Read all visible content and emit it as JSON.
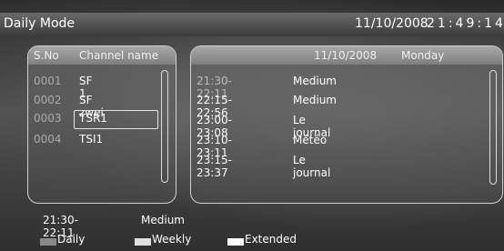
{
  "title_bar": {
    "title": "Daily Mode",
    "date": "11/10/2008",
    "time": "21:49:14"
  },
  "channel_panel": {
    "header": {
      "sno": "S.No",
      "name": "Channel name"
    },
    "channels": [
      {
        "sno": "0001",
        "name": "SF 1"
      },
      {
        "sno": "0002",
        "name": "SF zwei"
      },
      {
        "sno": "0003",
        "name": "TSR1"
      },
      {
        "sno": "0004",
        "name": "TSI1"
      }
    ],
    "selected_index": 2
  },
  "epg_panel": {
    "header": {
      "date": "11/10/2008",
      "day": "Monday"
    },
    "events": [
      {
        "time": "21:30-22:11",
        "title": "Medium"
      },
      {
        "time": "22:15-22:56",
        "title": "Medium"
      },
      {
        "time": "23:00-23:08",
        "title": "Le journal"
      },
      {
        "time": "23:10-23:11",
        "title": "Météo"
      },
      {
        "time": "23:15-23:37",
        "title": "Le journal"
      }
    ]
  },
  "info": {
    "time": "21:30-22:11",
    "title": "Medium"
  },
  "legend": {
    "daily": {
      "label": "Daily",
      "color": "#8a8a8a"
    },
    "weekly": {
      "label": "Weekly",
      "color": "#e0e0e0"
    },
    "extended": {
      "label": "Extended",
      "color": "#ffffff"
    }
  }
}
